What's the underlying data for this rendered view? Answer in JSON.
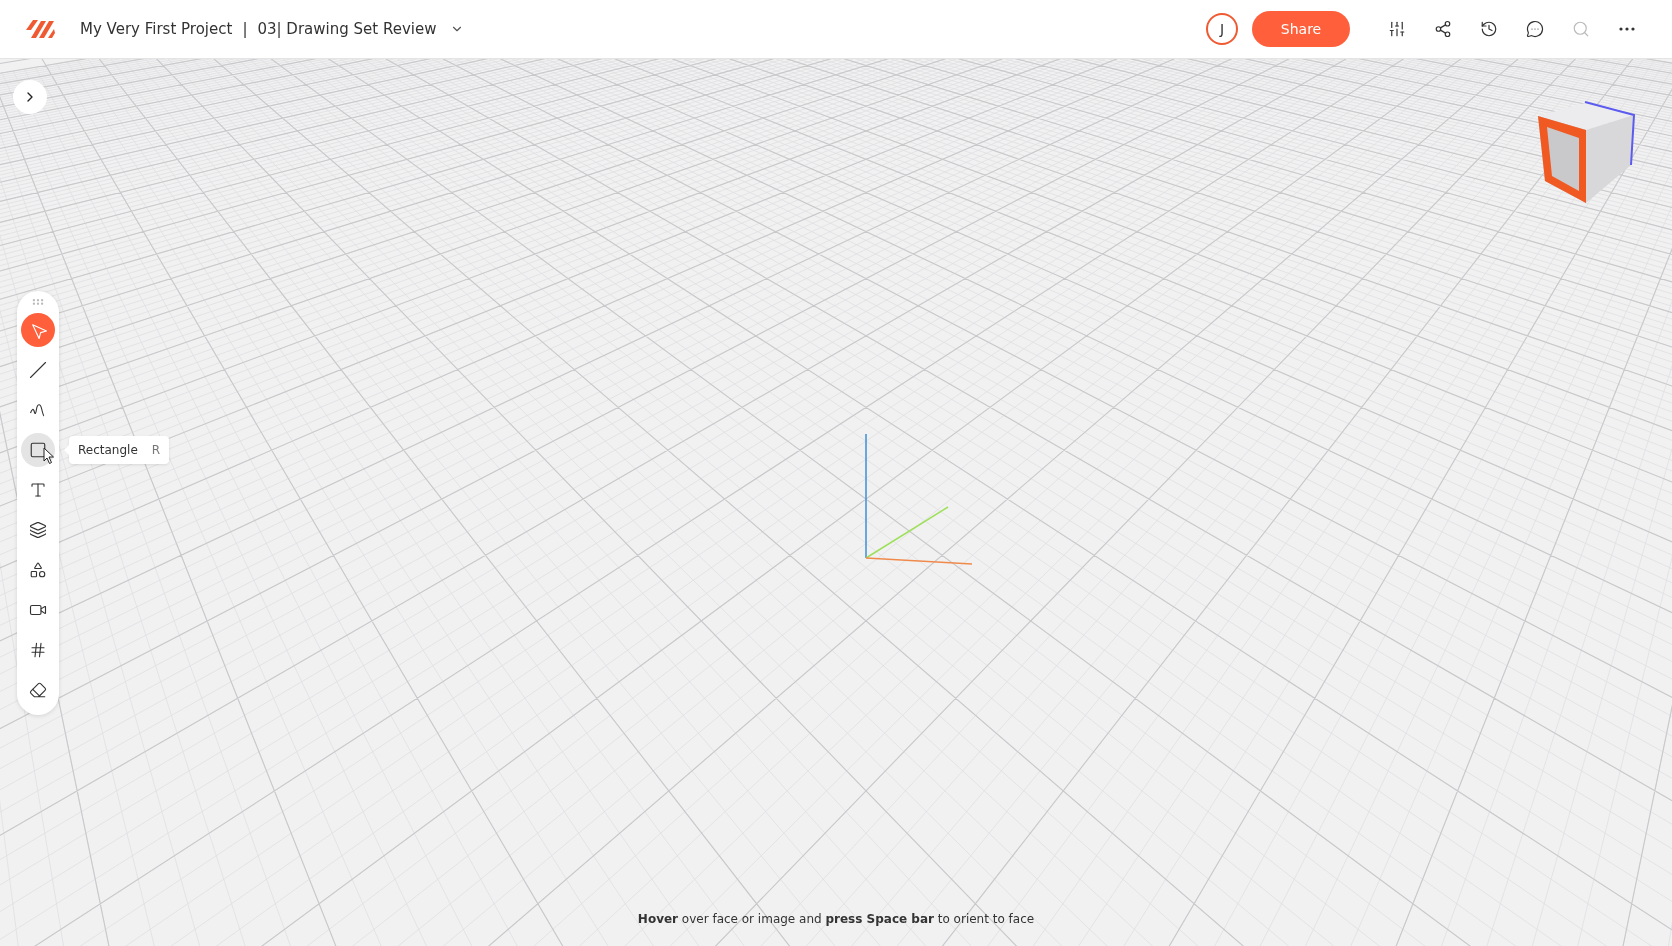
{
  "header": {
    "project": "My Very First Project",
    "separator": "|",
    "document": "03| Drawing Set Review",
    "avatar": "J",
    "share": "Share",
    "actions": [
      {
        "kind": "adjust"
      },
      {
        "kind": "share"
      },
      {
        "kind": "history"
      },
      {
        "kind": "comments"
      },
      {
        "kind": "search",
        "disabled": true
      },
      {
        "kind": "more"
      }
    ]
  },
  "tools": [
    {
      "kind": "select",
      "selected": true,
      "hovered": false
    },
    {
      "kind": "line",
      "selected": false,
      "hovered": false
    },
    {
      "kind": "curve",
      "selected": false,
      "hovered": false
    },
    {
      "kind": "rectangle",
      "selected": false,
      "hovered": true
    },
    {
      "kind": "text",
      "selected": false,
      "hovered": false
    },
    {
      "kind": "layers",
      "selected": false,
      "hovered": false
    },
    {
      "kind": "shapes",
      "selected": false,
      "hovered": false
    },
    {
      "kind": "camera",
      "selected": false,
      "hovered": false
    },
    {
      "kind": "grid",
      "selected": false,
      "hovered": false
    },
    {
      "kind": "eraser",
      "selected": false,
      "hovered": false
    }
  ],
  "tooltip": {
    "label": "Rectangle",
    "shortcut": "R"
  },
  "hint": "**Hover** over face or image and **press Space bar** to orient to face"
}
